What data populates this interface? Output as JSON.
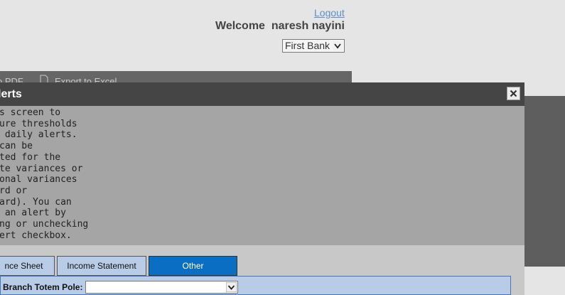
{
  "header": {
    "logout_label": "Logout",
    "welcome_text": "Welcome  naresh nayini",
    "bank_select_value": "First Bank"
  },
  "export_bar": {
    "pdf_label": "o PDF",
    "excel_label": "Export to Excel"
  },
  "modal": {
    "title": "lerts",
    "close_label": "×",
    "description": "s screen to\nure thresholds\n daily alerts.\ncan be\nted for the\nte variances or\nonal variances\nrd or\nard). You can\n an alert by\nng or unchecking\nert checkbox.",
    "tabs": [
      {
        "label": "nce Sheet",
        "active": false
      },
      {
        "label": "Income Statement",
        "active": false
      },
      {
        "label": "Other",
        "active": true
      }
    ],
    "filter": {
      "label": "Branch Totem Pole:",
      "value": ""
    }
  },
  "colors": {
    "title_bar": "#454545",
    "description_panel": "#a5a5a5",
    "tab_active": "#0a6ec2",
    "tab_inactive": "#b8cce8",
    "link": "#5b8fc9"
  }
}
